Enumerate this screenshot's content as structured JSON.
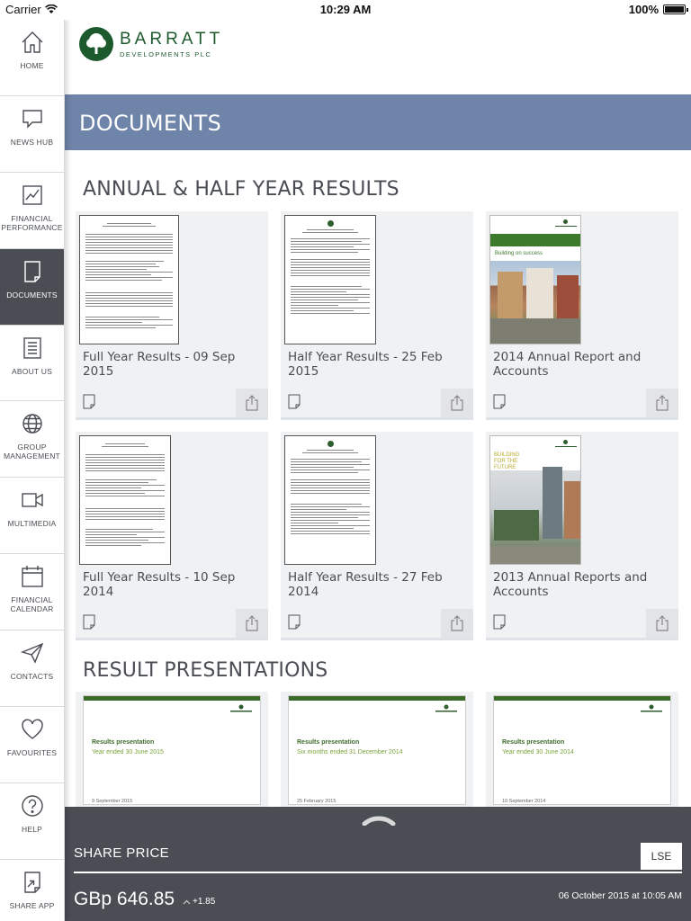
{
  "status": {
    "carrier": "Carrier",
    "time": "10:29 AM",
    "battery": "100%"
  },
  "brand": {
    "name": "BARRATT",
    "sub": "DEVELOPMENTS PLC"
  },
  "sidebar": {
    "items": [
      {
        "label": "HOME",
        "icon": "home-icon"
      },
      {
        "label": "NEWS HUB",
        "icon": "speech-bubble-icon"
      },
      {
        "label": "FINANCIAL PERFORMANCE",
        "icon": "chart-icon"
      },
      {
        "label": "DOCUMENTS",
        "icon": "document-icon",
        "active": true
      },
      {
        "label": "ABOUT US",
        "icon": "lines-doc-icon"
      },
      {
        "label": "GROUP MANAGEMENT",
        "icon": "globe-icon"
      },
      {
        "label": "MULTIMEDIA",
        "icon": "video-camera-icon"
      },
      {
        "label": "FINANCIAL CALENDAR",
        "icon": "calendar-icon"
      },
      {
        "label": "CONTACTS",
        "icon": "paper-plane-icon"
      },
      {
        "label": "FAVOURITES",
        "icon": "heart-icon"
      },
      {
        "label": "HELP",
        "icon": "question-icon"
      },
      {
        "label": "SHARE APP",
        "icon": "share-app-icon"
      }
    ]
  },
  "page": {
    "title": "DOCUMENTS"
  },
  "sections": {
    "annual": {
      "title": "ANNUAL & HALF YEAR RESULTS",
      "cards": [
        {
          "title": "Full Year Results - 09 Sep 2015"
        },
        {
          "title": "Half Year Results - 25 Feb 2015"
        },
        {
          "title": "2014 Annual Report and Accounts",
          "cover_text": "Building on success"
        },
        {
          "title": "Full Year Results - 10 Sep 2014"
        },
        {
          "title": "Half Year Results - 27 Feb 2014"
        },
        {
          "title": "2013 Annual Reports and Accounts",
          "cover_text": "BUILDING FOR THE FUTURE"
        }
      ]
    },
    "presentations": {
      "title": "RESULT PRESENTATIONS",
      "slides": [
        {
          "heading": "Results presentation",
          "subtitle": "Year ended 30 June 2015",
          "date": "9 September 2015"
        },
        {
          "heading": "Results presentation",
          "subtitle": "Six months ended 31 December 2014",
          "date": "25 February 2015"
        },
        {
          "heading": "Results presentation",
          "subtitle": "Year ended 30 June 2014",
          "date": "10 September 2014"
        }
      ]
    }
  },
  "share": {
    "label": "SHARE PRICE",
    "exchange": "LSE",
    "price": "GBp 646.85",
    "change": "+1.85",
    "updated": "06 October 2015 at 10:05 AM"
  },
  "colors": {
    "title_bar": "#6f84a9",
    "sidebar_active": "#4a4e54",
    "brand_green": "#1c5a2e"
  }
}
